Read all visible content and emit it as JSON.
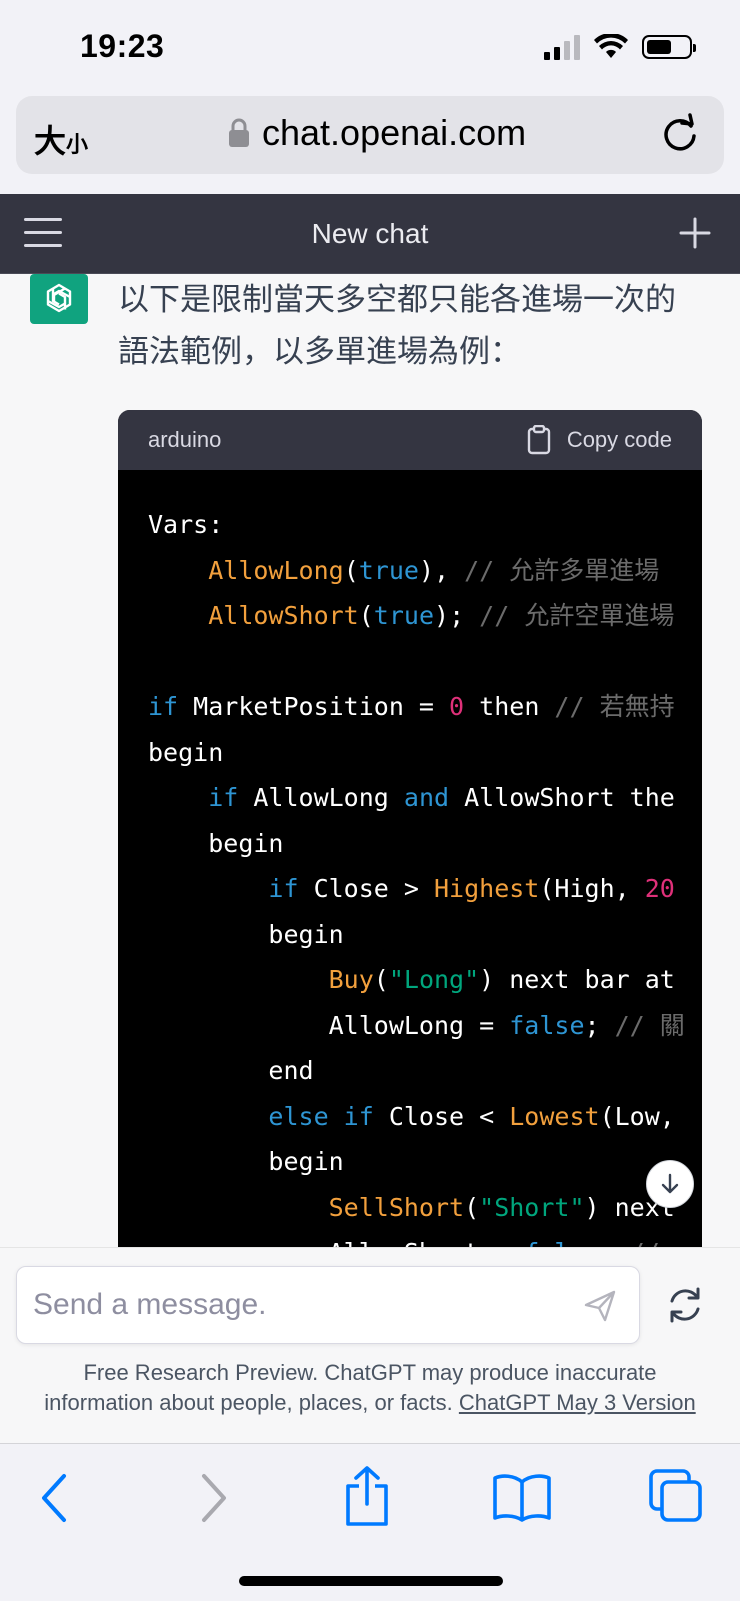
{
  "status_bar": {
    "time": "19:23"
  },
  "address_bar": {
    "text_size_big": "大",
    "text_size_small": "小",
    "url": "chat.openai.com"
  },
  "header": {
    "title": "New chat"
  },
  "message": {
    "line1": "以下是限制當天多空都只能各進場一次的",
    "line2": "語法範例，以多單進場為例："
  },
  "code_block": {
    "language": "arduino",
    "copy_label": "Copy code",
    "lines": {
      "l1": "Vars:",
      "l2_fn": "AllowLong",
      "l2_a": "(",
      "l2_kw": "true",
      "l2_b": "), ",
      "l2_cm": "// 允許多單進場",
      "l3_fn": "AllowShort",
      "l3_a": "(",
      "l3_kw": "true",
      "l3_b": "); ",
      "l3_cm": "// 允許空單進場",
      "l5_kw": "if",
      "l5_a": " MarketPosition = ",
      "l5_num": "0",
      "l5_b": " then ",
      "l5_cm": "// 若無持",
      "l6": "begin",
      "l7_kw": "if",
      "l7_a": " AllowLong ",
      "l7_kw2": "and",
      "l7_b": " AllowShort the",
      "l8": "begin",
      "l9_kw": "if",
      "l9_a": " Close > ",
      "l9_fn": "Highest",
      "l9_b": "(High, ",
      "l9_num": "20",
      "l10": "begin",
      "l11_fn": "Buy",
      "l11_a": "(",
      "l11_str": "\"Long\"",
      "l11_b": ") next bar at",
      "l12_a": "AllowLong = ",
      "l12_kw": "false",
      "l12_b": "; ",
      "l12_cm": "// 關",
      "l13": "end",
      "l14_kw": "else if",
      "l14_a": " Close < ",
      "l14_fn": "Lowest",
      "l14_b": "(Low,",
      "l15": "begin",
      "l16_fn": "SellShort",
      "l16_a": "(",
      "l16_str": "\"Short\"",
      "l16_b": ") next",
      "l17_a": "AllowShort = ",
      "l17_kw": "false",
      "l17_b": "; ",
      "l17_cm": "//"
    }
  },
  "composer": {
    "placeholder": "Send a message.",
    "disclaimer_line1": "Free Research Preview. ChatGPT may produce inaccurate",
    "disclaimer_line2": "information about people, places, or facts. ",
    "version_link": "ChatGPT May 3 Version"
  },
  "colors": {
    "accent": "#10a37f",
    "header_bg": "#343541",
    "code_bg": "#000000",
    "ios_blue": "#007aff"
  },
  "icons": [
    "signal-icon",
    "wifi-icon",
    "battery-icon",
    "lock-icon",
    "reload-icon",
    "menu-icon",
    "plus-icon",
    "openai-logo-icon",
    "clipboard-icon",
    "arrow-down-icon",
    "send-icon",
    "regenerate-icon",
    "back-icon",
    "forward-icon",
    "share-icon",
    "bookmarks-icon",
    "tabs-icon"
  ]
}
